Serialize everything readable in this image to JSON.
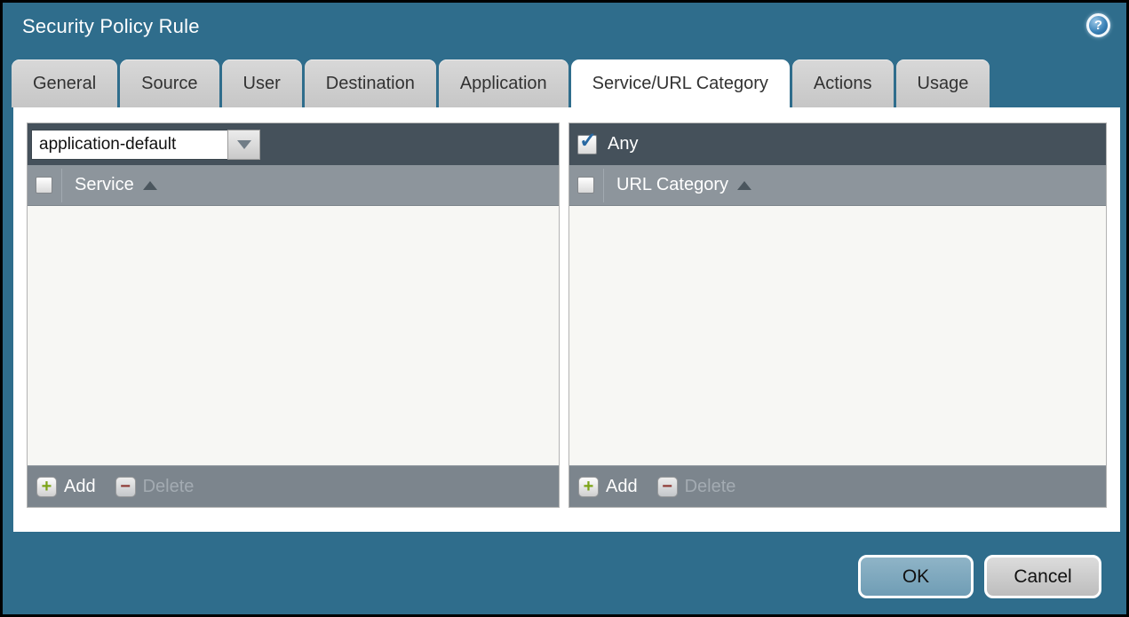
{
  "dialog": {
    "title": "Security Policy Rule"
  },
  "glyphs": {
    "help": "?",
    "check": "✓",
    "plus": "+",
    "minus": "−"
  },
  "tabs": [
    {
      "label": "General",
      "active": false
    },
    {
      "label": "Source",
      "active": false
    },
    {
      "label": "User",
      "active": false
    },
    {
      "label": "Destination",
      "active": false
    },
    {
      "label": "Application",
      "active": false
    },
    {
      "label": "Service/URL Category",
      "active": true
    },
    {
      "label": "Actions",
      "active": false
    },
    {
      "label": "Usage",
      "active": false
    }
  ],
  "service_panel": {
    "dropdown": {
      "value": "application-default"
    },
    "header": {
      "label": "Service",
      "sort": "ascending",
      "checkbox_checked": false
    },
    "rows": [],
    "footer": {
      "add_label": "Add",
      "delete_label": "Delete",
      "add_enabled": true,
      "delete_enabled": false
    }
  },
  "url_panel": {
    "any": {
      "label": "Any",
      "checked": true
    },
    "header": {
      "label": "URL Category",
      "sort": "ascending",
      "checkbox_checked": false
    },
    "rows": [],
    "footer": {
      "add_label": "Add",
      "delete_label": "Delete",
      "add_enabled": true,
      "delete_enabled": false
    }
  },
  "buttons": {
    "ok": "OK",
    "cancel": "Cancel"
  },
  "colors": {
    "dialog_bg": "#2f6d8c",
    "panel_bar": "#45515b",
    "header_row": "#8d959c",
    "panel_body": "#f7f7f4",
    "footer_bar": "#7c858d",
    "tab_inactive": "#cccccc",
    "tab_active": "#ffffff",
    "ok_button": "#7da7bf",
    "cancel_button": "#cccccc",
    "add_plus": "#7ca417",
    "delete_minus": "#8e3a35",
    "checkmark": "#2868a2"
  }
}
